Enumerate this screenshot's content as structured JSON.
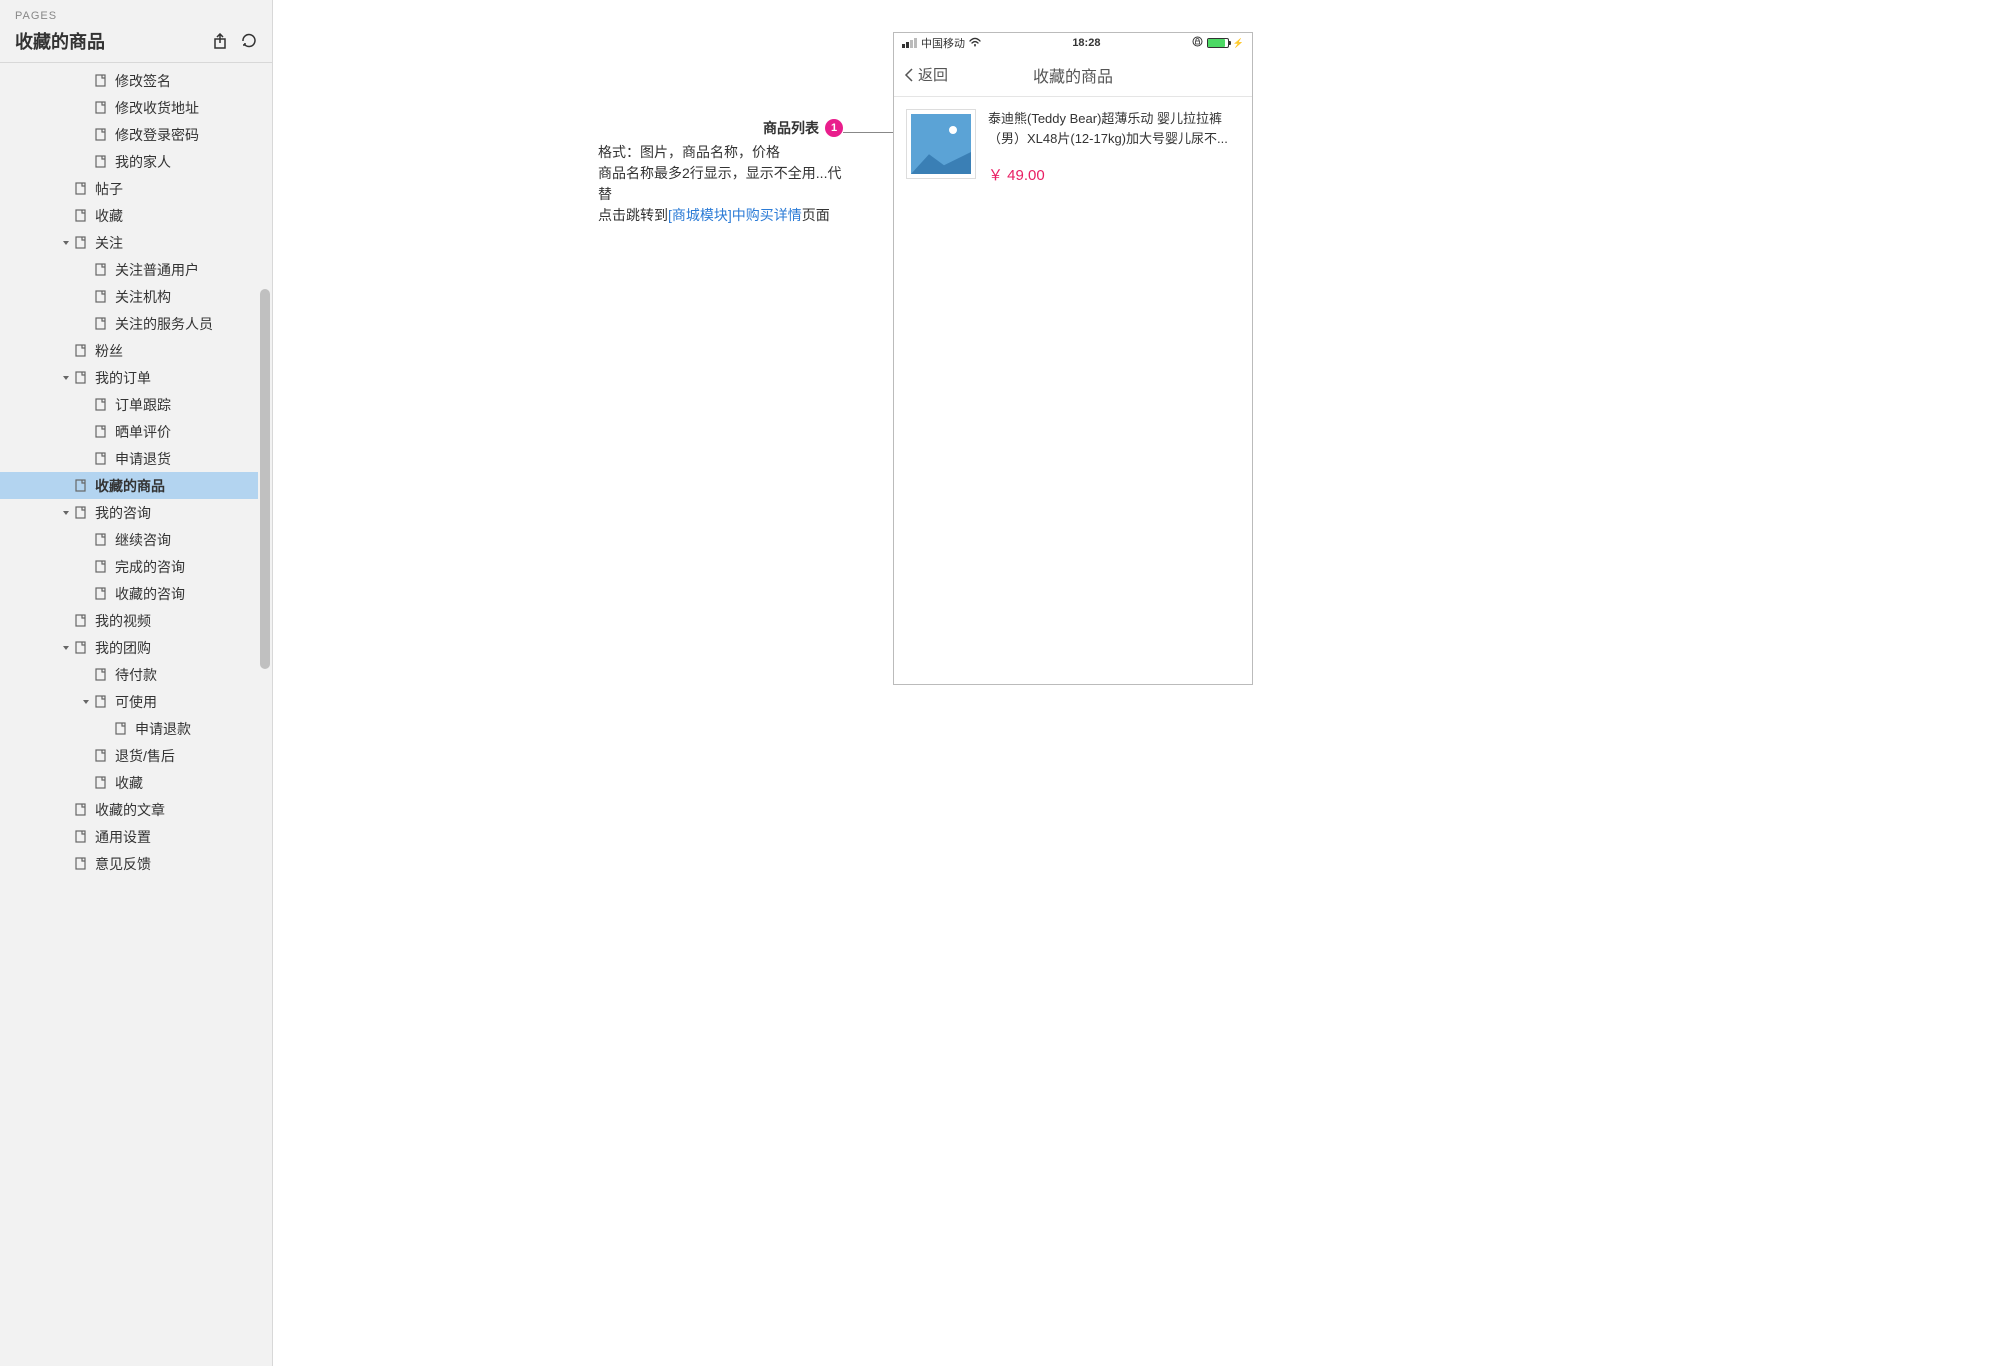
{
  "sidebar": {
    "header_label": "PAGES",
    "title": "收藏的商品",
    "tree": [
      {
        "label": "修改签名",
        "indent": 3,
        "chevron": false
      },
      {
        "label": "修改收货地址",
        "indent": 3,
        "chevron": false
      },
      {
        "label": "修改登录密码",
        "indent": 3,
        "chevron": false
      },
      {
        "label": "我的家人",
        "indent": 3,
        "chevron": false
      },
      {
        "label": "帖子",
        "indent": 2,
        "chevron": false
      },
      {
        "label": "收藏",
        "indent": 2,
        "chevron": false
      },
      {
        "label": "关注",
        "indent": 2,
        "chevron": true
      },
      {
        "label": "关注普通用户",
        "indent": 3,
        "chevron": false
      },
      {
        "label": "关注机构",
        "indent": 3,
        "chevron": false
      },
      {
        "label": "关注的服务人员",
        "indent": 3,
        "chevron": false
      },
      {
        "label": "粉丝",
        "indent": 2,
        "chevron": false
      },
      {
        "label": "我的订单",
        "indent": 2,
        "chevron": true
      },
      {
        "label": "订单跟踪",
        "indent": 3,
        "chevron": false
      },
      {
        "label": "晒单评价",
        "indent": 3,
        "chevron": false
      },
      {
        "label": "申请退货",
        "indent": 3,
        "chevron": false
      },
      {
        "label": "收藏的商品",
        "indent": 2,
        "chevron": false,
        "selected": true
      },
      {
        "label": "我的咨询",
        "indent": 2,
        "chevron": true
      },
      {
        "label": "继续咨询",
        "indent": 3,
        "chevron": false
      },
      {
        "label": "完成的咨询",
        "indent": 3,
        "chevron": false
      },
      {
        "label": "收藏的咨询",
        "indent": 3,
        "chevron": false
      },
      {
        "label": "我的视频",
        "indent": 2,
        "chevron": false
      },
      {
        "label": "我的团购",
        "indent": 2,
        "chevron": true
      },
      {
        "label": "待付款",
        "indent": 3,
        "chevron": false
      },
      {
        "label": "可使用",
        "indent": 3,
        "chevron": true
      },
      {
        "label": "申请退款",
        "indent": 4,
        "chevron": false
      },
      {
        "label": "退货/售后",
        "indent": 3,
        "chevron": false
      },
      {
        "label": "收藏",
        "indent": 3,
        "chevron": false
      },
      {
        "label": "收藏的文章",
        "indent": 2,
        "chevron": false
      },
      {
        "label": "通用设置",
        "indent": 2,
        "chevron": false
      },
      {
        "label": "意见反馈",
        "indent": 2,
        "chevron": false
      }
    ]
  },
  "annotation": {
    "title": "商品列表",
    "badge": "1",
    "line1": "格式：图片，商品名称，价格",
    "line2": "商品名称最多2行显示，显示不全用...代替",
    "line3_prefix": "点击跳转到",
    "line3_link": "[商城模块]中购买详情",
    "line3_suffix": "页面"
  },
  "phone": {
    "status": {
      "carrier": "中国移动",
      "time": "18:28"
    },
    "nav": {
      "back_label": "返回",
      "title": "收藏的商品"
    },
    "product": {
      "name": "泰迪熊(Teddy Bear)超薄乐动 婴儿拉拉裤（男）XL48片(12-17kg)加大号婴儿尿不...",
      "price": "￥ 49.00"
    }
  }
}
